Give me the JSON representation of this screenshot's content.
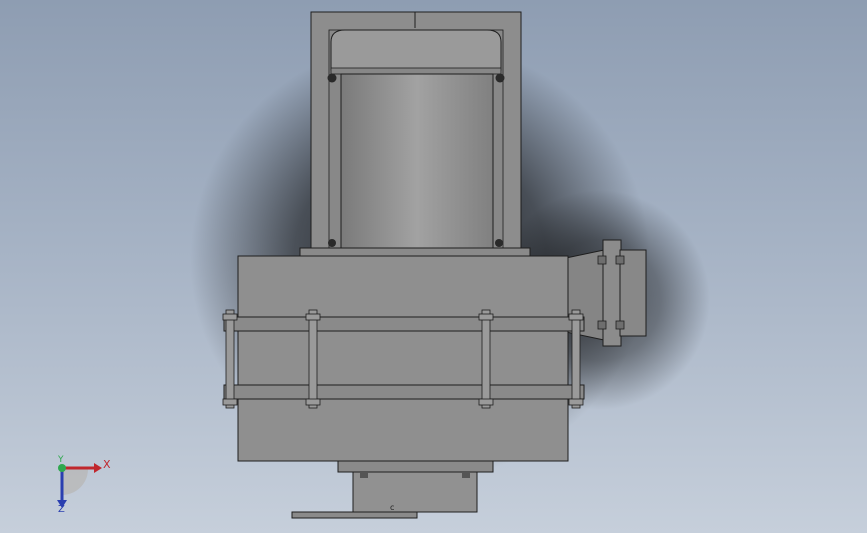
{
  "view": {
    "background_top": "#8e9db2",
    "background_bottom": "#c6cfdb",
    "model_color": "#8f8f8f"
  },
  "triad": {
    "x_label": "X",
    "y_label": "Y",
    "z_label": "Z",
    "x_color": "#c0272d",
    "y_color": "#2fa84f",
    "z_color": "#2a3fb0"
  }
}
